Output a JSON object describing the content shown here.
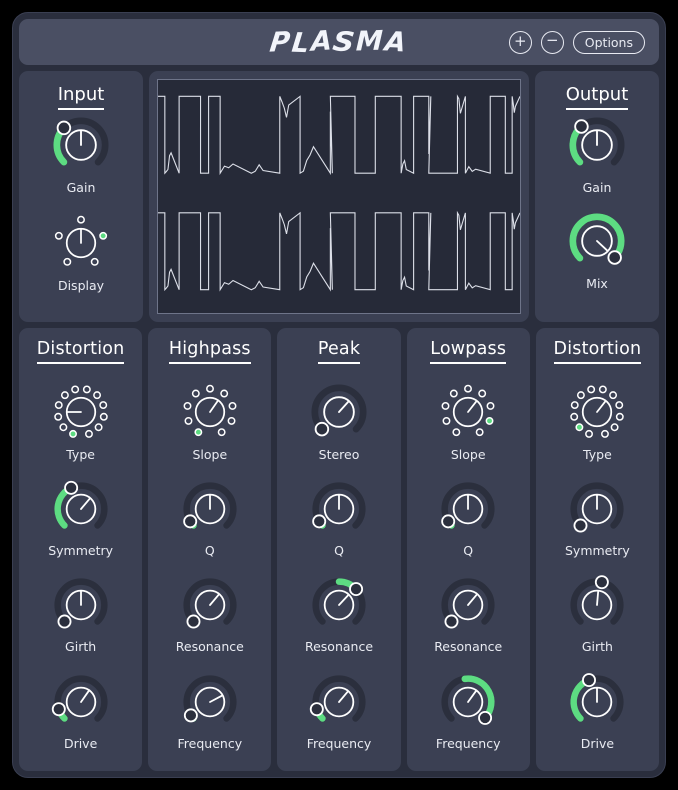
{
  "app": {
    "title": "PLASMA",
    "title_letters": [
      "P",
      "L",
      "A",
      "S",
      "M",
      "A"
    ]
  },
  "header": {
    "zoom_in_label": "+",
    "zoom_out_label": "−",
    "options_label": "Options"
  },
  "colors": {
    "window_bg": "#2a2e3d",
    "panel_bg": "#3b4053",
    "header_bg": "#4a4f63",
    "scope_bg": "#262a38",
    "accent_green": "#5ddc82",
    "track_dark": "#2b2f3d",
    "outline": "#ffffff",
    "text": "#e9ebf2"
  },
  "scope": {
    "channels": 2,
    "border_color": "#6e7489",
    "waveform": "clipped-square"
  },
  "input_panel": {
    "title": "Input",
    "controls": [
      {
        "name": "gain",
        "label": "Gain",
        "type": "knob",
        "value": 0.32,
        "arc_from": -135,
        "arc_to": -45,
        "pointer": 0
      },
      {
        "name": "display",
        "label": "Display",
        "type": "selector",
        "dots": 5,
        "selected": 3
      }
    ]
  },
  "output_panel": {
    "title": "Output",
    "controls": [
      {
        "name": "gain",
        "label": "Gain",
        "type": "knob",
        "value": 0.34,
        "arc_from": -135,
        "arc_to": -40,
        "pointer": 0
      },
      {
        "name": "mix",
        "label": "Mix",
        "type": "knob",
        "value": 0.96,
        "arc_from": -135,
        "arc_to": 133,
        "pointer": 133
      }
    ]
  },
  "columns": [
    {
      "name": "distortion-left",
      "title": "Distortion",
      "controls": [
        {
          "name": "type",
          "label": "Type",
          "type": "selector12",
          "dots": 12,
          "selected": 0,
          "pointer": -90
        },
        {
          "name": "symmetry",
          "label": "Symmetry",
          "type": "knob",
          "value": 0.3,
          "arc_from": -135,
          "arc_to": -25,
          "pointer": 40
        },
        {
          "name": "girth",
          "label": "Girth",
          "type": "knob",
          "value": 0.0,
          "arc_from": -135,
          "arc_to": -135,
          "pointer": 0
        },
        {
          "name": "drive",
          "label": "Drive",
          "type": "knob",
          "value": 0.12,
          "arc_from": -135,
          "arc_to": -108,
          "pointer": 35
        }
      ]
    },
    {
      "name": "highpass",
      "title": "Highpass",
      "controls": [
        {
          "name": "slope",
          "label": "Slope",
          "type": "selector9",
          "dots": 9,
          "selected": 0,
          "pointer": 35
        },
        {
          "name": "q",
          "label": "Q",
          "type": "knob",
          "value": 0.05,
          "arc_from": -135,
          "arc_to": -122,
          "pointer": 0
        },
        {
          "name": "resonance",
          "label": "Resonance",
          "type": "knob",
          "value": 0.0,
          "arc_from": -135,
          "arc_to": -135,
          "pointer": 40
        },
        {
          "name": "frequency",
          "label": "Frequency",
          "type": "knob",
          "value": 0.04,
          "arc_from": -135,
          "arc_to": -125,
          "pointer": 62
        }
      ]
    },
    {
      "name": "peak",
      "title": "Peak",
      "controls": [
        {
          "name": "stereo",
          "label": "Stereo",
          "type": "knob",
          "value": 0.0,
          "arc_from": -135,
          "arc_to": -135,
          "pointer": 42
        },
        {
          "name": "q",
          "label": "Q",
          "type": "knob",
          "value": 0.05,
          "arc_from": -135,
          "arc_to": -122,
          "pointer": 0
        },
        {
          "name": "resonance",
          "label": "Resonance",
          "type": "knob",
          "value": 0.62,
          "arc_from": 0,
          "arc_to": 47,
          "pointer": 43
        },
        {
          "name": "frequency",
          "label": "Frequency",
          "type": "knob",
          "value": 0.12,
          "arc_from": -135,
          "arc_to": -108,
          "pointer": 40
        }
      ]
    },
    {
      "name": "lowpass",
      "title": "Lowpass",
      "controls": [
        {
          "name": "slope",
          "label": "Slope",
          "type": "selector9",
          "dots": 9,
          "selected": 7,
          "pointer": 38
        },
        {
          "name": "q",
          "label": "Q",
          "type": "knob",
          "value": 0.05,
          "arc_from": -135,
          "arc_to": -122,
          "pointer": 0
        },
        {
          "name": "resonance",
          "label": "Resonance",
          "type": "knob",
          "value": 0.0,
          "arc_from": -135,
          "arc_to": -135,
          "pointer": 40
        },
        {
          "name": "frequency",
          "label": "Frequency",
          "type": "knob",
          "value": 0.88,
          "arc_from": -8,
          "arc_to": 133,
          "pointer": 36
        }
      ]
    },
    {
      "name": "distortion-right",
      "title": "Distortion",
      "controls": [
        {
          "name": "type",
          "label": "Type",
          "type": "selector12",
          "dots": 12,
          "selected": 1,
          "pointer": 38
        },
        {
          "name": "symmetry",
          "label": "Symmetry",
          "type": "knob",
          "value": 0.0,
          "arc_from": -135,
          "arc_to": -135,
          "pointer": 0
        },
        {
          "name": "girth",
          "label": "Girth",
          "type": "knob",
          "value": 0.02,
          "arc_from": 5,
          "arc_to": 12,
          "pointer": 5
        },
        {
          "name": "drive",
          "label": "Drive",
          "type": "knob",
          "value": 0.3,
          "arc_from": -135,
          "arc_to": -20,
          "pointer": 0
        }
      ]
    }
  ]
}
